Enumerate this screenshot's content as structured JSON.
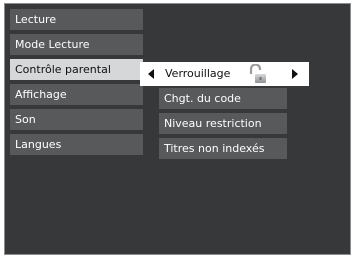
{
  "menu": {
    "items": [
      {
        "label": "Lecture"
      },
      {
        "label": "Mode Lecture"
      },
      {
        "label": "Contrôle parental"
      },
      {
        "label": "Affichage"
      },
      {
        "label": "Son"
      },
      {
        "label": "Langues"
      }
    ],
    "selected_index": 2
  },
  "selector": {
    "label": "Verrouillage",
    "icon": "unlocked-padlock-icon"
  },
  "submenu": {
    "items": [
      {
        "label": "Chgt. du code"
      },
      {
        "label": "Niveau restriction"
      },
      {
        "label": "Titres non indexés"
      }
    ]
  },
  "colors": {
    "background": "#37383a",
    "item": "#57595b",
    "selected": "#d6d7d8",
    "highlight": "#ffffff"
  }
}
